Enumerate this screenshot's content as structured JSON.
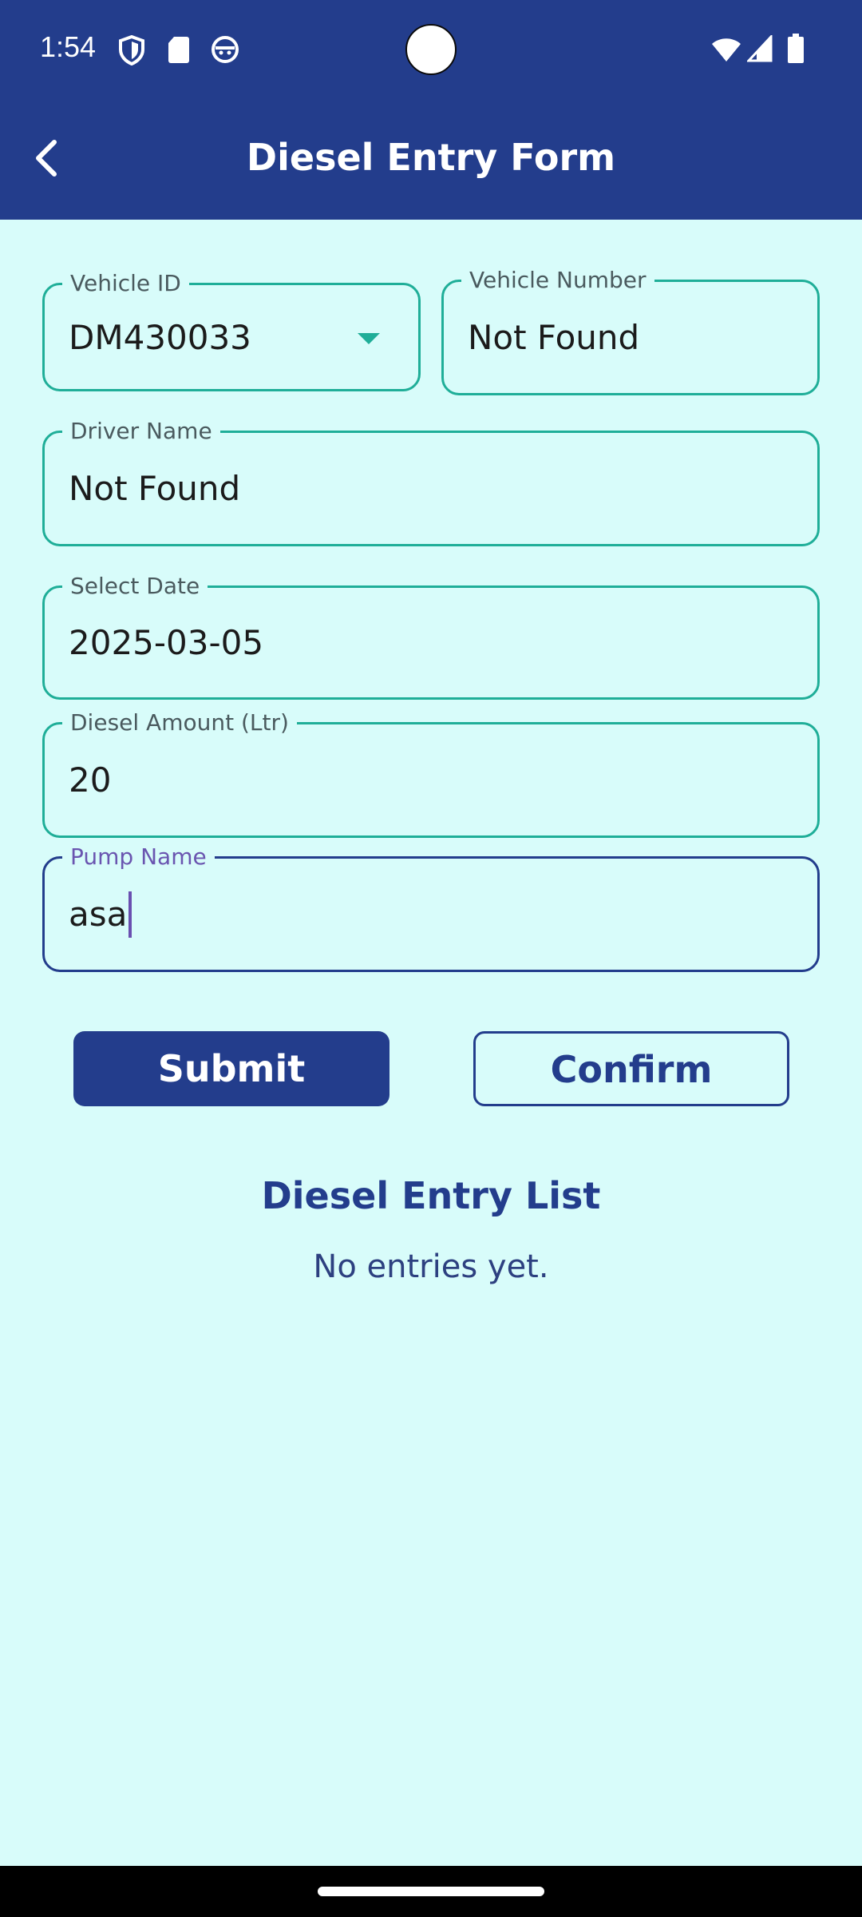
{
  "status_bar": {
    "time": "1:54",
    "left_icons": [
      "shield-icon",
      "sd-card-icon",
      "android-face-icon"
    ],
    "right_icons": [
      "wifi-icon",
      "signal-icon",
      "battery-icon"
    ]
  },
  "app_bar": {
    "title": "Diesel Entry Form",
    "back_icon": "chevron-left-icon",
    "color": "#233d8c"
  },
  "form": {
    "vehicle_id": {
      "label": "Vehicle ID",
      "value": "DM430033"
    },
    "vehicle_number": {
      "label": "Vehicle Number",
      "value": "Not Found"
    },
    "driver_name": {
      "label": "Driver Name",
      "value": "Not Found"
    },
    "select_date": {
      "label": "Select Date",
      "value": "2025-03-05"
    },
    "diesel_amount": {
      "label": "Diesel Amount (Ltr)",
      "value": "20"
    },
    "pump_name": {
      "label": "Pump Name",
      "value": "asa"
    }
  },
  "actions": {
    "submit_label": "Submit",
    "confirm_label": "Confirm"
  },
  "entry_list": {
    "title": "Diesel Entry List",
    "empty_text": "No entries yet."
  },
  "colors": {
    "primary": "#233d8c",
    "field_border": "#1fae98",
    "background": "#d8fcfa"
  }
}
